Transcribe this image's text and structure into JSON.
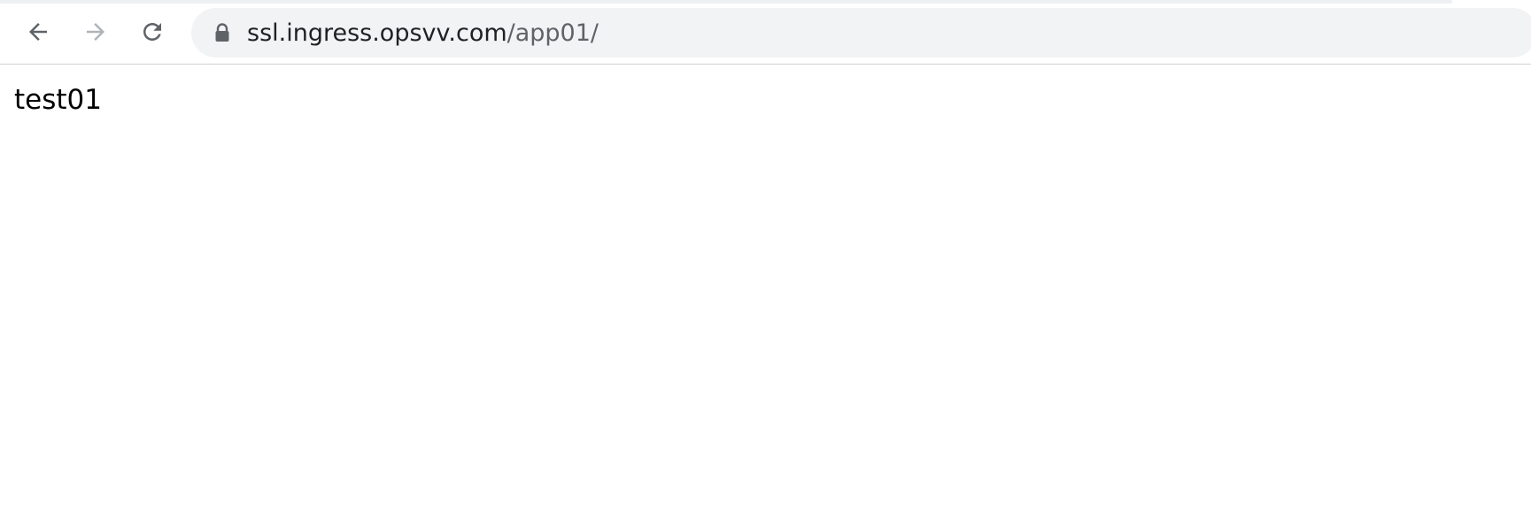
{
  "toolbar": {
    "back_icon": "arrow-left-icon",
    "forward_icon": "arrow-right-icon",
    "reload_icon": "reload-icon",
    "forward_enabled": false
  },
  "omnibox": {
    "secure_icon": "lock-icon",
    "url_host": "ssl.ingress.opsvv.com",
    "url_path": "/app01/"
  },
  "page": {
    "body_text": "test01"
  },
  "colors": {
    "omnibox_bg": "#f1f3f4",
    "icon_active": "#5f6368",
    "icon_disabled": "#b0b3b8",
    "host_text": "#202124",
    "path_text": "#5f6368"
  }
}
